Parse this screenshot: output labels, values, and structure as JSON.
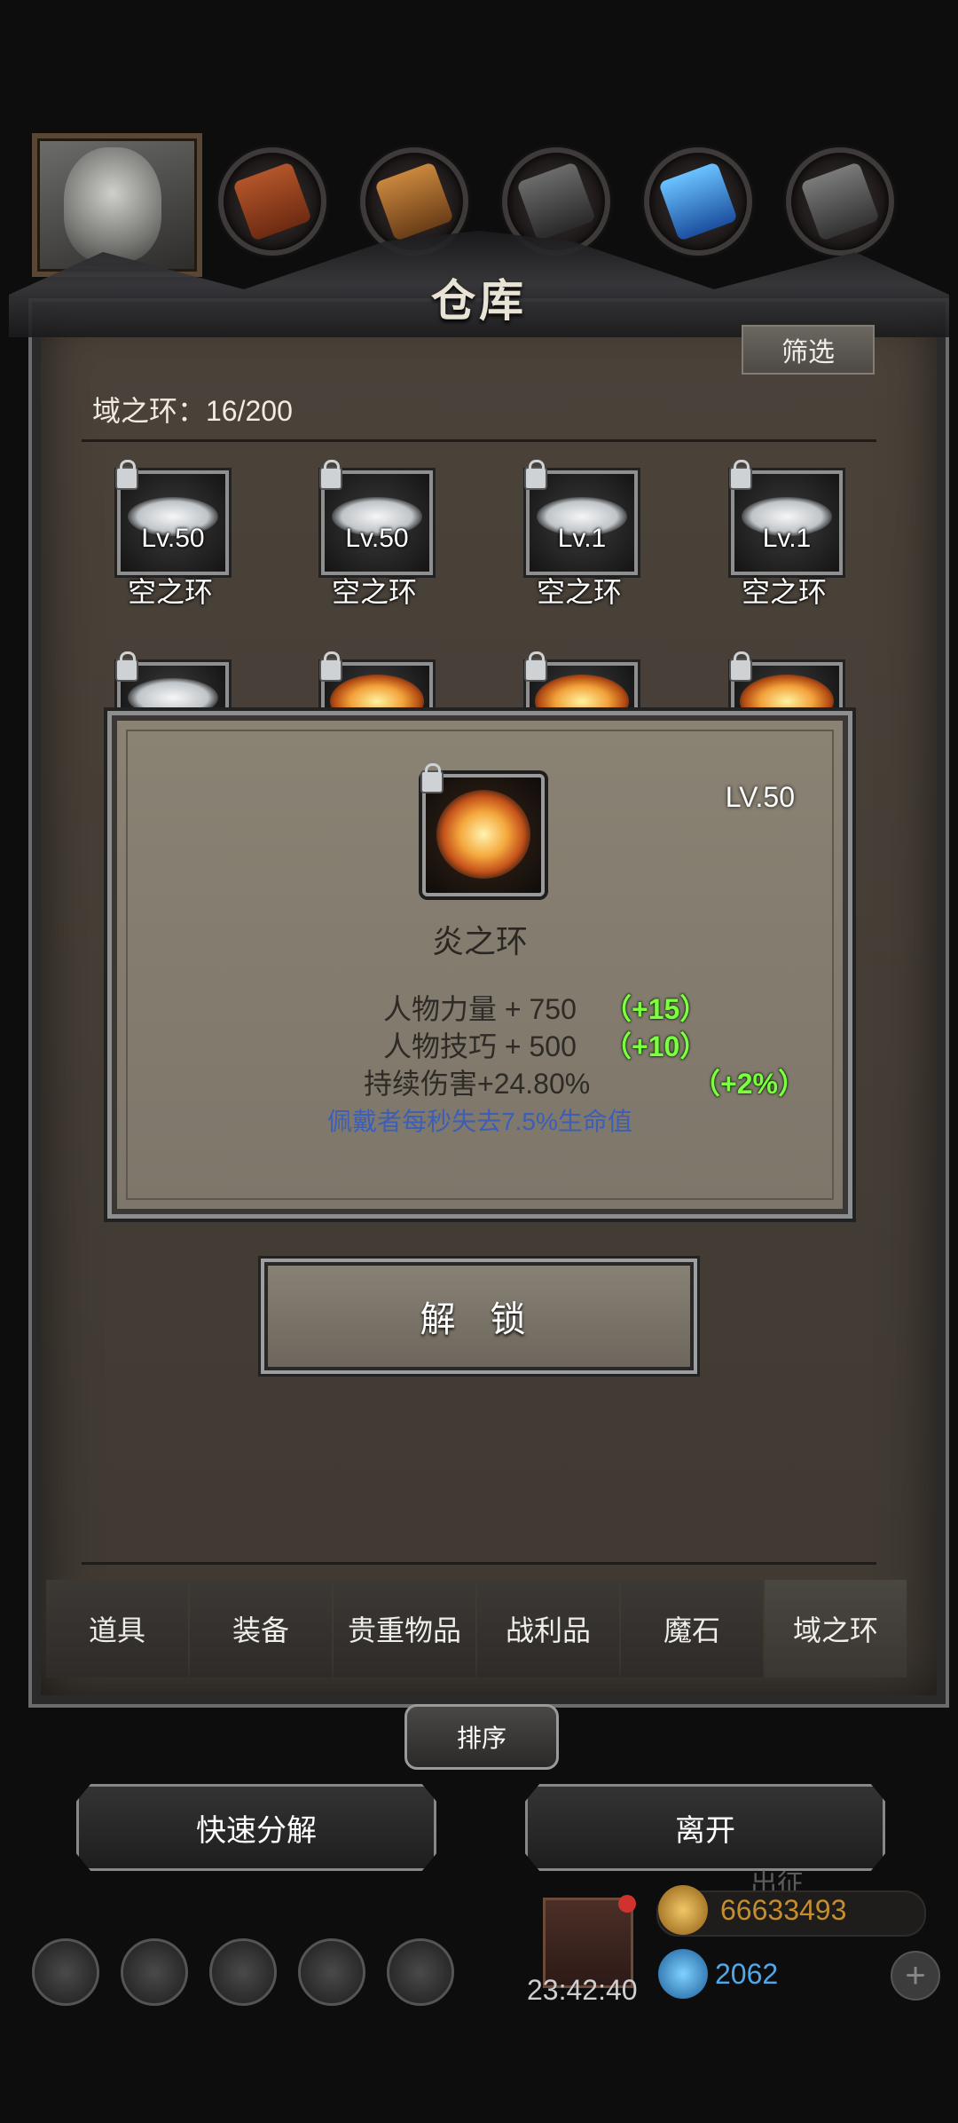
{
  "resources": {
    "icons": [
      "leather-icon",
      "wood-icon",
      "iron-icon",
      "crystal-icon",
      "metal-icon"
    ]
  },
  "warehouse": {
    "title": "仓库",
    "filter_label": "筛选",
    "count_label": "域之环：16/200"
  },
  "grid": [
    {
      "level": "Lv.50",
      "name": "空之环",
      "type": "cloud"
    },
    {
      "level": "Lv.50",
      "name": "空之环",
      "type": "cloud"
    },
    {
      "level": "Lv.1",
      "name": "空之环",
      "type": "cloud"
    },
    {
      "level": "Lv.1",
      "name": "空之环",
      "type": "cloud"
    }
  ],
  "grid_row2": [
    "cloud",
    "fire",
    "fire",
    "fire"
  ],
  "popup": {
    "level": "LV.50",
    "name": "炎之环",
    "stats": [
      {
        "text": "人物力量 + 750",
        "bonus": "（+15）"
      },
      {
        "text": "人物技巧 + 500",
        "bonus": "（+10）"
      },
      {
        "text": "持续伤害+24.80%",
        "bonus": "（+2%）"
      }
    ],
    "description": "佩戴者每秒失去7.5%生命值"
  },
  "unlock_label": "解 锁",
  "tabs": [
    "道具",
    "装备",
    "贵重物品",
    "战利品",
    "魔石",
    "域之环"
  ],
  "sort_label": "排序",
  "quick_decompose_label": "快速分解",
  "leave_label": "离开",
  "bottom": {
    "timer": "23:42:40",
    "gold": "66633493",
    "gems": "2062",
    "expedition": "出征"
  }
}
